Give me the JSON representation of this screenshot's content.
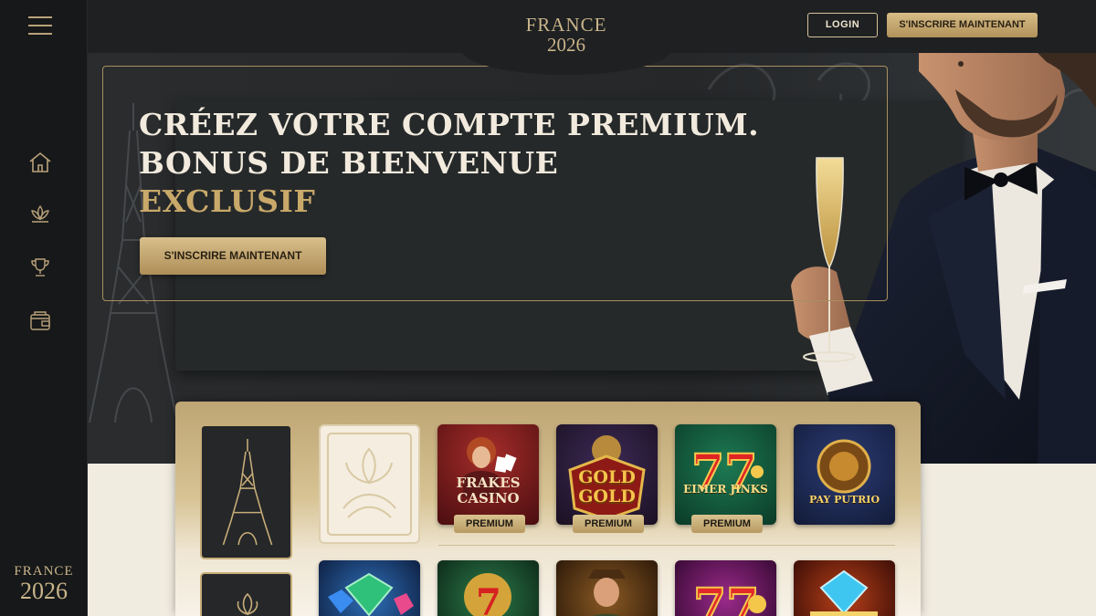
{
  "header": {
    "brand_line1": "FRANCE",
    "brand_line2": "2026",
    "login_label": "LOGIN",
    "signup_label": "S'INSCRIRE MAINTENANT"
  },
  "sidebar": {
    "items": [
      {
        "icon": "home-icon"
      },
      {
        "icon": "lotus-icon"
      },
      {
        "icon": "trophy-icon"
      },
      {
        "icon": "wallet-icon"
      }
    ],
    "logo_line1": "FRANCE",
    "logo_line2": "2026"
  },
  "hero": {
    "title_line1": "CRÉEZ VOTRE COMPTE PREMIUM.",
    "title_line2": "BONUS DE BIENVENUE",
    "title_line3": "EXCLUSIF",
    "cta_label": "S'INSCRIRE MAINTENANT"
  },
  "games": {
    "row1": [
      {
        "title": "FRAKES CASINO",
        "badge": "PREMIUM"
      },
      {
        "title": "GOLD GOLD",
        "badge": "PREMIUM"
      },
      {
        "title": "EIMER JINKS",
        "badge": "PREMIUM"
      },
      {
        "title": "PAY PUTRIO",
        "badge": ""
      }
    ],
    "row2": [
      {
        "title": ""
      },
      {
        "title": ""
      },
      {
        "title": ""
      },
      {
        "title": ""
      },
      {
        "title": ""
      }
    ]
  },
  "colors": {
    "gold": "#c9a96a",
    "dark": "#1b1d1f",
    "cream": "#f1ece0"
  }
}
